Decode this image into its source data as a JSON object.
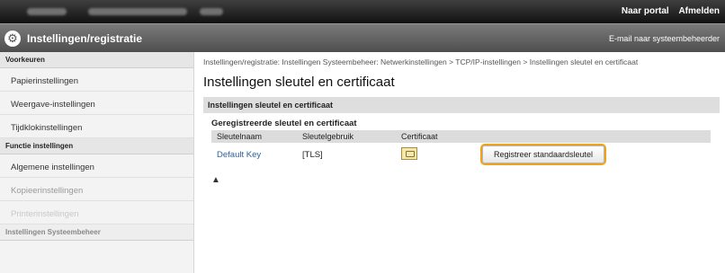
{
  "header": {
    "links": [
      "Naar portal",
      "Afmelden"
    ],
    "subtitle": "Instellingen/registratie",
    "system_mail": "E-mail naar systeembeheerder"
  },
  "sidebar": {
    "section1": "Voorkeuren",
    "items1": [
      "Papierinstellingen",
      "Weergave-instellingen",
      "Tijdklokinstellingen"
    ],
    "section2": "Functie instellingen",
    "items2": [
      "Algemene instellingen",
      "Kopieerinstellingen",
      "Printerinstellingen"
    ],
    "section3": "Instellingen Systeembeheer"
  },
  "main": {
    "breadcrumb": "Instellingen/registratie: Instellingen Systeembeheer: Netwerkinstellingen > TCP/IP-instellingen > Instellingen sleutel en certificaat",
    "title": "Instellingen sleutel en certificaat",
    "section_bar": "Instellingen sleutel en certificaat",
    "table_title": "Geregistreerde sleutel en certificaat",
    "columns": [
      "Sleutelnaam",
      "Sleutelgebruik",
      "Certificaat",
      ""
    ],
    "rows": [
      {
        "key_name": "Default Key",
        "usage": "[TLS]",
        "button": "Registreer standaardsleutel"
      }
    ],
    "top_link": "▲"
  }
}
